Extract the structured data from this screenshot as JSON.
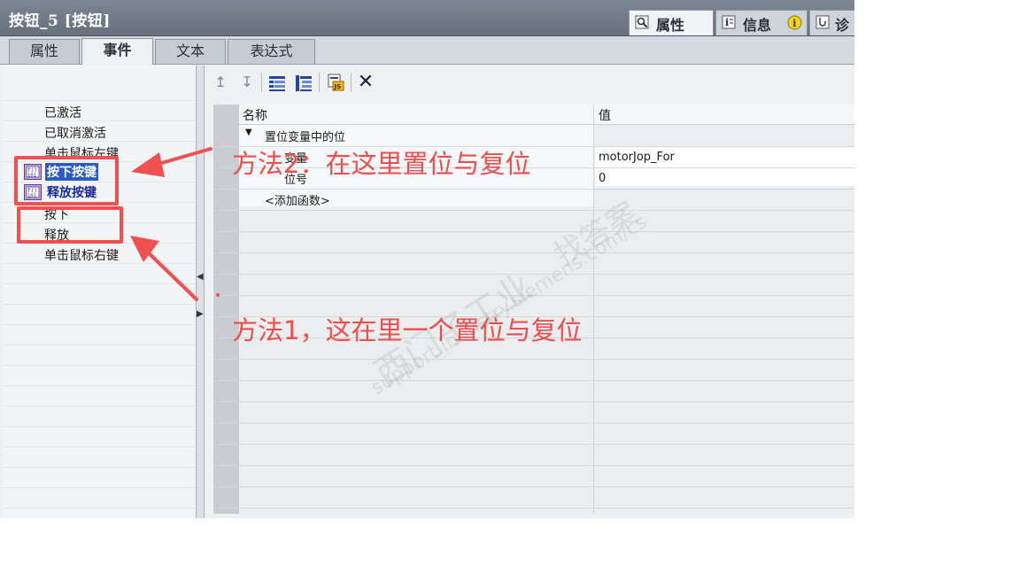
{
  "window": {
    "title": "按钮_5 [按钮]"
  },
  "right_tabs": [
    {
      "label": "属性",
      "icon": "properties-icon"
    },
    {
      "label": "信息",
      "icon": "info-icon"
    },
    {
      "label": "诊",
      "icon": "diagnostics-icon"
    }
  ],
  "tabs": [
    {
      "label": "属性"
    },
    {
      "label": "事件"
    },
    {
      "label": "文本"
    },
    {
      "label": "表达式"
    }
  ],
  "events": {
    "items": [
      "已激活",
      "已取消激活",
      "单击鼠标左键",
      "按下按键",
      "释放按键",
      "按下",
      "释放",
      "单击鼠标右键"
    ]
  },
  "toolbar": {
    "icons": [
      "move-up-icon",
      "move-down-icon",
      "expand-icon",
      "collapse-icon",
      "script-icon",
      "delete-icon"
    ]
  },
  "table": {
    "headers": {
      "name": "名称",
      "value": "值"
    },
    "rows": [
      {
        "name": "置位变量中的位",
        "value": ""
      },
      {
        "name": "变量",
        "value": "motorJop_For"
      },
      {
        "name": "位号",
        "value": "0"
      },
      {
        "name": "<添加函数>",
        "value": ""
      }
    ]
  },
  "annotations": {
    "method2": "方法2：在这里置位与复位",
    "method1": "方法1，这在里一个置位与复位"
  },
  "watermark": {
    "line1": "找答案",
    "line2": "西门子工业",
    "line3": "support.industry.siemens.com/cs"
  },
  "colors": {
    "annotation": "#f0504f",
    "selection": "#2a5ac6",
    "titlebar": "#707a87"
  }
}
